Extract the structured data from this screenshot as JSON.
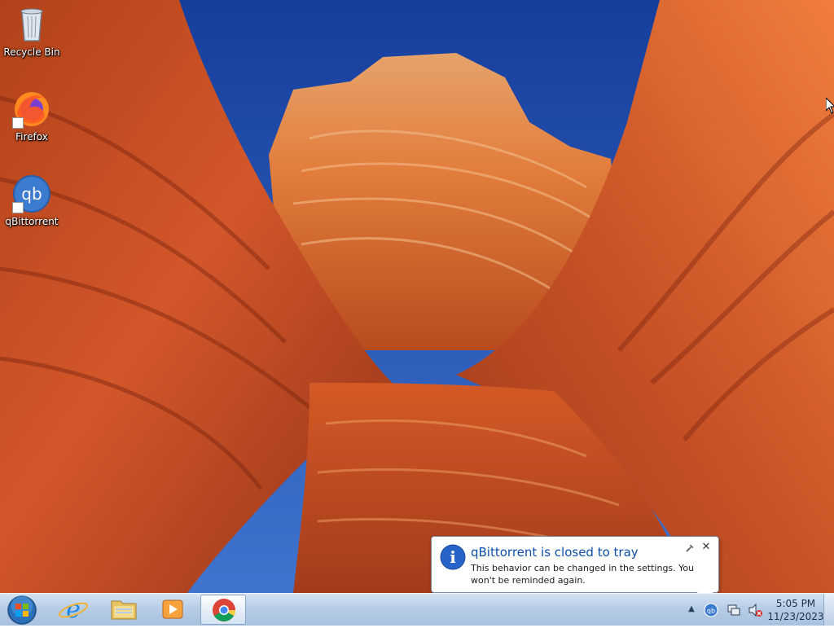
{
  "desktop": {
    "icons": [
      {
        "label": "Recycle Bin",
        "icon": "recycle-bin-icon"
      },
      {
        "label": "Firefox",
        "icon": "firefox-icon",
        "shortcut": true
      },
      {
        "label": "qBittorrent",
        "icon": "qbittorrent-icon",
        "shortcut": true
      }
    ]
  },
  "taskbar": {
    "start": {
      "icon": "windows-start-orb-icon"
    },
    "pinned": [
      {
        "name": "internet-explorer",
        "icon": "internet-explorer-icon",
        "active": false
      },
      {
        "name": "windows-explorer",
        "icon": "folder-icon",
        "active": false
      },
      {
        "name": "media-player",
        "icon": "media-player-icon",
        "active": false
      },
      {
        "name": "chrome",
        "icon": "chrome-icon",
        "active": true
      }
    ],
    "tray": {
      "show_hidden_glyph": "▲",
      "icons": [
        "qbittorrent-tray-icon",
        "network-icon",
        "volume-muted-icon"
      ],
      "time": "5:05 PM",
      "date": "11/23/2023"
    }
  },
  "notification": {
    "icon": "info-icon",
    "info_glyph": "i",
    "close_glyph": "✕",
    "title": "qBittorrent is closed to tray",
    "body": "This behavior can be changed in the settings. You won't be reminded again."
  },
  "colors": {
    "sky": "#1f4fb3",
    "rock_orange": "#e06a2a",
    "title_blue": "#0d4fa8",
    "taskbar": "#b7cde6"
  }
}
